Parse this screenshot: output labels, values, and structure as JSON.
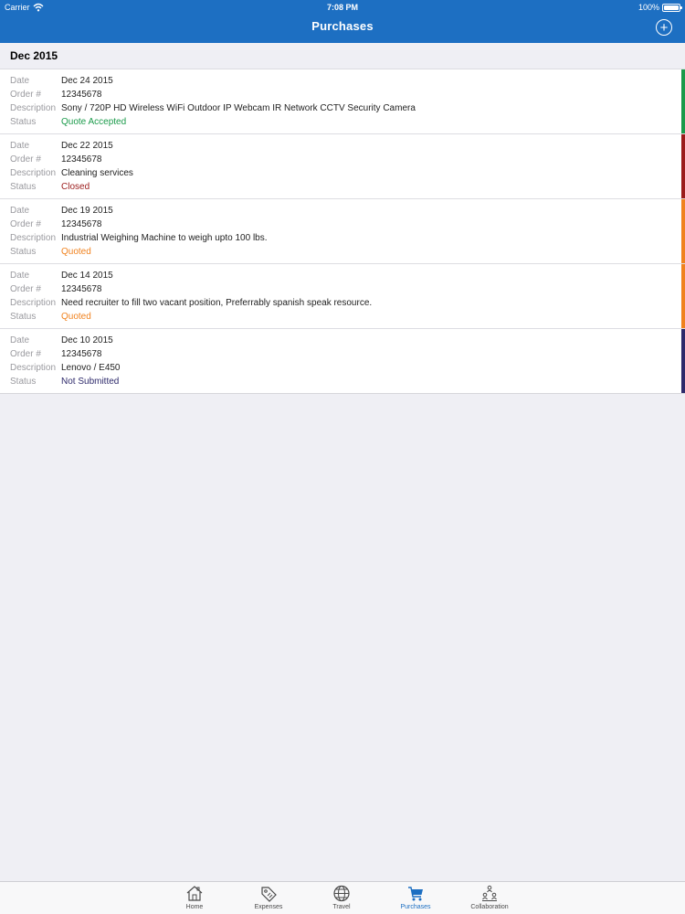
{
  "status_bar": {
    "carrier": "Carrier",
    "time": "7:08 PM",
    "battery": "100%"
  },
  "nav": {
    "title": "Purchases",
    "add_icon": "plus-circle-icon"
  },
  "section": {
    "title": "Dec 2015"
  },
  "labels": {
    "date": "Date",
    "order": "Order #",
    "description": "Description",
    "status": "Status"
  },
  "purchases": [
    {
      "date": "Dec 24 2015",
      "order": "12345678",
      "description": "Sony / 720P HD Wireless WiFi Outdoor IP Webcam IR Network CCTV Security Camera",
      "status": "Quote Accepted",
      "status_color": "#1a9a4a"
    },
    {
      "date": "Dec 22 2015",
      "order": "12345678",
      "description": "Cleaning services",
      "status": "Closed",
      "status_color": "#9b1b1b"
    },
    {
      "date": "Dec 19 2015",
      "order": "12345678",
      "description": "Industrial Weighing Machine to weigh upto 100 lbs.",
      "status": "Quoted",
      "status_color": "#f0821e"
    },
    {
      "date": "Dec 14 2015",
      "order": "12345678",
      "description": "Need recruiter to fill two vacant position, Preferrably spanish speak resource.",
      "status": "Quoted",
      "status_color": "#f0821e"
    },
    {
      "date": "Dec 10 2015",
      "order": "12345678",
      "description": "Lenovo / E450",
      "status": "Not Submitted",
      "status_color": "#2e2a6b"
    }
  ],
  "tabs": [
    {
      "label": "Home",
      "icon": "home-icon",
      "active": false
    },
    {
      "label": "Expenses",
      "icon": "tag-icon",
      "active": false
    },
    {
      "label": "Travel",
      "icon": "globe-icon",
      "active": false
    },
    {
      "label": "Purchases",
      "icon": "cart-icon",
      "active": true
    },
    {
      "label": "Collaboration",
      "icon": "people-network-icon",
      "active": false
    }
  ],
  "colors": {
    "nav_bar": "#1d6fc2",
    "active_tab": "#1d6fc2",
    "background": "#efeff4"
  }
}
